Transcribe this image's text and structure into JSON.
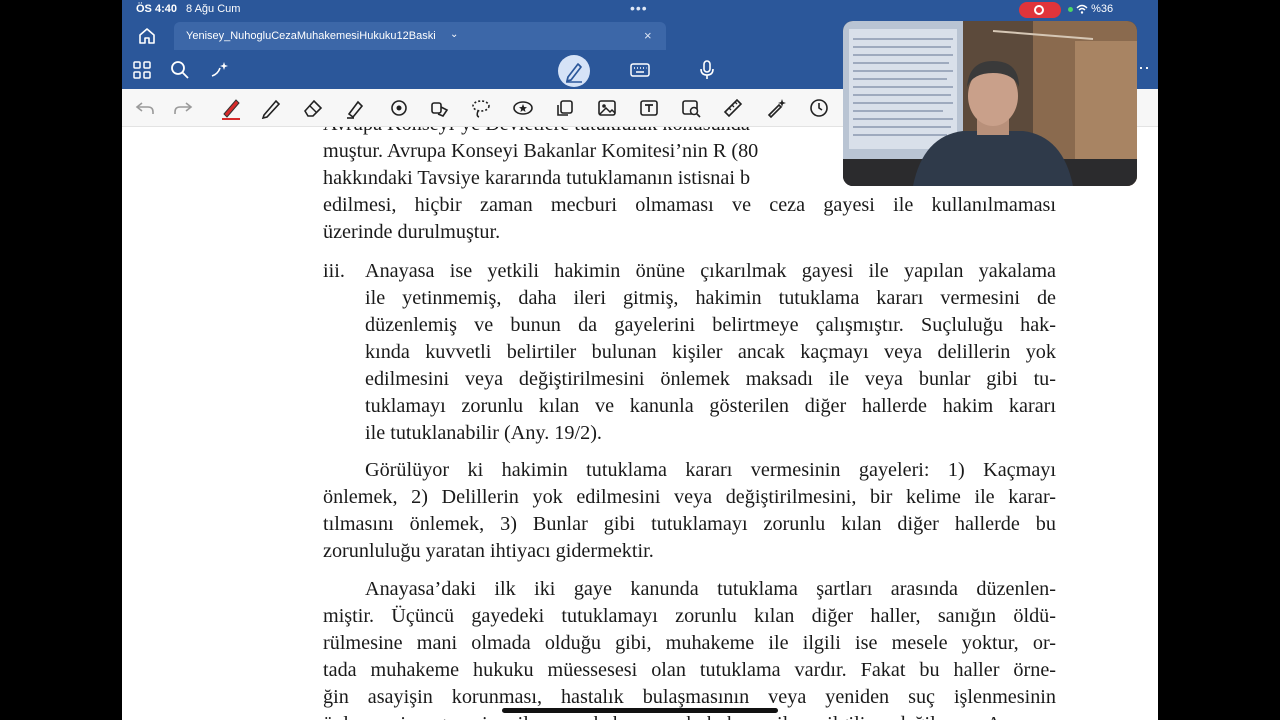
{
  "status": {
    "time": "ÖS 4:40",
    "date": "8 Ağu Cum",
    "battery": "%36"
  },
  "tab": {
    "title": "Yenisey_NuhogluCezaMuhakemesiHukuku12Baski"
  },
  "icons": {
    "top": [
      "home-icon",
      "apps-grid-icon",
      "search-icon",
      "sparkle-icon",
      "pen-mode-icon",
      "keyboard-icon",
      "microphone-icon",
      "more-icon"
    ],
    "draw": [
      "undo-icon",
      "redo-icon",
      "red-pen-icon",
      "pencil-icon",
      "eraser-icon",
      "highlighter-icon",
      "shape-icon",
      "stamp-icon",
      "lasso-icon",
      "star-icon",
      "copy-icon",
      "image-icon",
      "text-box-icon",
      "image-search-icon",
      "ruler-icon",
      "magic-pen-icon",
      "timer-icon"
    ]
  },
  "document": {
    "lines_top": [
      "Avrupa Konseyi’ye Devletlere tutukluluk konusunda",
      "muştur. Avrupa Konseyi Bakanlar Komitesi’nin R (80",
      "hakkındaki Tavsiye kararında tutuklamanın istisnai b",
      "edilmesi, hiçbir zaman mecburi olmaması ve ceza gayesi ile kullanılmaması",
      "üzerinde durulmuştur."
    ],
    "item_number": "iii.",
    "item_lines": [
      "Anayasa ise yetkili hakimin önüne çıkarılmak gayesi ile yapılan yakalama",
      "ile yetinmemiş, daha ileri gitmiş, hakimin tutuklama kararı vermesini de",
      "düzenlemiş ve bunun da gayelerini belirtmeye çalışmıştır. Suçluluğu hak-",
      "kında kuvvetli belirtiler bulunan kişiler ancak kaçmayı veya delillerin yok",
      "edilmesini veya değiştirilmesini önlemek maksadı ile veya bunlar gibi tu-",
      "tuklamayı zorunlu kılan ve kanunla gösterilen diğer hallerde hakim kararı",
      "ile tutuklanabilir (Any. 19/2)."
    ],
    "para2_lines": [
      "Görülüyor ki hakimin tutuklama kararı vermesinin gayeleri: 1) Kaçmayı",
      "önlemek, 2) Delillerin yok edilmesini veya değiştirilmesini, bir kelime ile karar-",
      "tılmasını önlemek, 3) Bunlar gibi tutuklamayı zorunlu kılan diğer hallerde bu",
      "zorunluluğu yaratan ihtiyacı gidermektir."
    ],
    "para3_lines": [
      "Anayasa’daki ilk iki gaye kanunda tutuklama şartları arasında düzenlen-",
      "miştir. Üçüncü gayedeki tutuklamayı zorunlu kılan diğer haller, sanığın öldü-",
      "rülmesine mani olmada olduğu gibi, muhakeme ile ilgili ise mesele yoktur, or-",
      "tada muhakeme hukuku müessesesi olan tutuklama vardır. Fakat bu haller örne-",
      "ğin asayişin korunması, hastalık bulaşmasının veya yeniden suç işlenmesinin",
      "önlenmesi gayesi ile muhakeme hukuku ile ilgili değilse, Anayasa"
    ]
  },
  "colors": {
    "accent": "#2b579a",
    "record": "#e0343b",
    "pen": "#d62b2b"
  }
}
